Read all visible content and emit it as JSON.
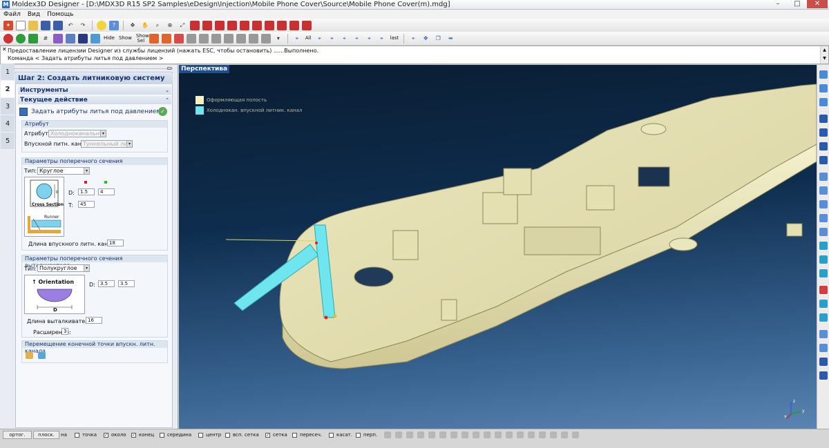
{
  "window": {
    "app_icon": "M",
    "title": "Moldex3D Designer - [D:\\MDX3D R15 SP2 Samples\\eDesign\\Injection\\Mobile Phone Cover\\Source\\Mobile Phone Cover(m).mdg]",
    "controls": {
      "minimize": "–",
      "maximize": "□",
      "close": "✕"
    }
  },
  "menu": [
    "Файл",
    "Вид",
    "Помощь"
  ],
  "toolbar2": {
    "hide_label": "Hide",
    "show_label": "Show",
    "show_sel_label": "Show Sel",
    "all_label": "All",
    "last_label": "last"
  },
  "console": {
    "lines": [
      "Предоставление лицензии Designer из службы лицензий (нажать ESC, чтобы остановить) ......Выполнено.",
      "Команда < Задать атрибуты литья под давлением >"
    ]
  },
  "wizard": {
    "step_title": "Шаг 2: Создать литниковую систему",
    "steps": [
      "1",
      "2",
      "3",
      "4",
      "5"
    ],
    "active_step": "2",
    "tools_header": "Инструменты",
    "current_action_header": "Текущее действие",
    "action_label": "Задать атрибуты литья под давлением",
    "attribute": {
      "title": "Атрибут",
      "attr_label": "Атрибут:",
      "attr_value": "Холодноканальный",
      "gate_label": "Впускной питн. канал:",
      "gate_value": "Туннельный литн"
    },
    "cross_section": {
      "title": "Параметры поперечного сечения",
      "type_label": "Тип:",
      "type_value": "Круглое",
      "diagram_caption": "Cross Section",
      "runner_caption": "Runner",
      "d_label": "D:",
      "d1": "1.5",
      "d2": "4",
      "t_label": "T:",
      "t_value": "45",
      "gate_length_label": "Длина впускного литн. канала:",
      "gate_length_value": "18"
    },
    "ejector": {
      "title": "Параметры поперечного сечения выталкивателя",
      "type_label": "Тип:",
      "type_value": "Полукруглое",
      "orientation_caption": "Orientation",
      "d_caption": "D",
      "d_label": "D:",
      "d1": "3.5",
      "d2": "3.5",
      "length_label": "Длина выталкивателя:",
      "length_value": "16",
      "expansion_label": "Расширение:",
      "expansion_value": "3"
    },
    "endpoint": {
      "title": "Перемещение конечной точки впускн. литн. канала"
    }
  },
  "viewport": {
    "label": "Перспектива",
    "legend": [
      {
        "name": "Оформляющая полость",
        "color": "#f6f3c2"
      },
      {
        "name": "Холоднокан. впускной литник. канал",
        "color": "#6fe6ee"
      }
    ],
    "axis": {
      "x": "x",
      "y": "y",
      "z": "z"
    }
  },
  "statusbar": {
    "ortho": "ортог.",
    "plane": "плоск.",
    "snaps": [
      {
        "label": "на",
        "checked": false
      },
      {
        "label": "точка",
        "checked": false
      },
      {
        "label": "около",
        "checked": true
      },
      {
        "label": "конец",
        "checked": true
      },
      {
        "label": "середина",
        "checked": false
      },
      {
        "label": "центр",
        "checked": false
      },
      {
        "label": "всп. сетка",
        "checked": false
      },
      {
        "label": "сетка",
        "checked": true
      },
      {
        "label": "пересеч.",
        "checked": false
      },
      {
        "label": "касат.",
        "checked": false
      },
      {
        "label": "перп.",
        "checked": false
      }
    ],
    "check_mark": "✓"
  },
  "colors": {
    "accent": "#1e4f8c",
    "part": "#e9e5ba",
    "runner": "#6fe6ee"
  }
}
